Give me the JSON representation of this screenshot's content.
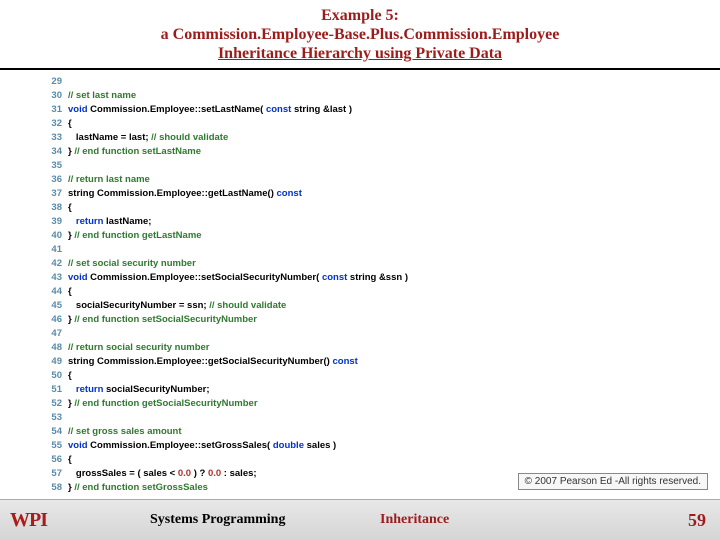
{
  "header": {
    "line1": "Example 5:",
    "line2": "a Commission.Employee-Base.Plus.Commission.Employee",
    "line3": "Inheritance Hierarchy using Private Data"
  },
  "code": {
    "lines": [
      {
        "n": 29,
        "t": []
      },
      {
        "n": 30,
        "t": [
          {
            "c": "cm",
            "s": "// set last name"
          }
        ]
      },
      {
        "n": 31,
        "t": [
          {
            "c": "kw",
            "s": "void"
          },
          {
            "c": "txt",
            "s": " Commission.Employee::setLastName( "
          },
          {
            "c": "kw",
            "s": "const"
          },
          {
            "c": "txt",
            "s": " string &last )"
          }
        ]
      },
      {
        "n": 32,
        "t": [
          {
            "c": "txt",
            "s": "{"
          }
        ]
      },
      {
        "n": 33,
        "t": [
          {
            "c": "txt",
            "s": "   lastName = last; "
          },
          {
            "c": "cm",
            "s": "// should validate"
          }
        ]
      },
      {
        "n": 34,
        "t": [
          {
            "c": "txt",
            "s": "} "
          },
          {
            "c": "cm",
            "s": "// end function setLastName"
          }
        ]
      },
      {
        "n": 35,
        "t": []
      },
      {
        "n": 36,
        "t": [
          {
            "c": "cm",
            "s": "// return last name"
          }
        ]
      },
      {
        "n": 37,
        "t": [
          {
            "c": "txt",
            "s": "string Commission.Employee::getLastName() "
          },
          {
            "c": "kw",
            "s": "const"
          }
        ]
      },
      {
        "n": 38,
        "t": [
          {
            "c": "txt",
            "s": "{"
          }
        ]
      },
      {
        "n": 39,
        "t": [
          {
            "c": "txt",
            "s": "   "
          },
          {
            "c": "kw",
            "s": "return"
          },
          {
            "c": "txt",
            "s": " lastName;"
          }
        ]
      },
      {
        "n": 40,
        "t": [
          {
            "c": "txt",
            "s": "} "
          },
          {
            "c": "cm",
            "s": "// end function getLastName"
          }
        ]
      },
      {
        "n": 41,
        "t": []
      },
      {
        "n": 42,
        "t": [
          {
            "c": "cm",
            "s": "// set social security number"
          }
        ]
      },
      {
        "n": 43,
        "t": [
          {
            "c": "kw",
            "s": "void"
          },
          {
            "c": "txt",
            "s": " Commission.Employee::setSocialSecurityNumber( "
          },
          {
            "c": "kw",
            "s": "const"
          },
          {
            "c": "txt",
            "s": " string &ssn )"
          }
        ]
      },
      {
        "n": 44,
        "t": [
          {
            "c": "txt",
            "s": "{"
          }
        ]
      },
      {
        "n": 45,
        "t": [
          {
            "c": "txt",
            "s": "   socialSecurityNumber = ssn; "
          },
          {
            "c": "cm",
            "s": "// should validate"
          }
        ]
      },
      {
        "n": 46,
        "t": [
          {
            "c": "txt",
            "s": "} "
          },
          {
            "c": "cm",
            "s": "// end function setSocialSecurityNumber"
          }
        ]
      },
      {
        "n": 47,
        "t": []
      },
      {
        "n": 48,
        "t": [
          {
            "c": "cm",
            "s": "// return social security number"
          }
        ]
      },
      {
        "n": 49,
        "t": [
          {
            "c": "txt",
            "s": "string Commission.Employee::getSocialSecurityNumber() "
          },
          {
            "c": "kw",
            "s": "const"
          }
        ]
      },
      {
        "n": 50,
        "t": [
          {
            "c": "txt",
            "s": "{"
          }
        ]
      },
      {
        "n": 51,
        "t": [
          {
            "c": "txt",
            "s": "   "
          },
          {
            "c": "kw",
            "s": "return"
          },
          {
            "c": "txt",
            "s": " socialSecurityNumber;"
          }
        ]
      },
      {
        "n": 52,
        "t": [
          {
            "c": "txt",
            "s": "} "
          },
          {
            "c": "cm",
            "s": "// end function getSocialSecurityNumber"
          }
        ]
      },
      {
        "n": 53,
        "t": []
      },
      {
        "n": 54,
        "t": [
          {
            "c": "cm",
            "s": "// set gross sales amount"
          }
        ]
      },
      {
        "n": 55,
        "t": [
          {
            "c": "kw",
            "s": "void"
          },
          {
            "c": "txt",
            "s": " Commission.Employee::setGrossSales( "
          },
          {
            "c": "kw",
            "s": "double"
          },
          {
            "c": "txt",
            "s": " sales )"
          }
        ]
      },
      {
        "n": 56,
        "t": [
          {
            "c": "txt",
            "s": "{"
          }
        ]
      },
      {
        "n": 57,
        "t": [
          {
            "c": "txt",
            "s": "   grossSales = ( sales < "
          },
          {
            "c": "num",
            "s": "0.0"
          },
          {
            "c": "txt",
            "s": " ) ? "
          },
          {
            "c": "num",
            "s": "0.0"
          },
          {
            "c": "txt",
            "s": " : sales;"
          }
        ]
      },
      {
        "n": 58,
        "t": [
          {
            "c": "txt",
            "s": "} "
          },
          {
            "c": "cm",
            "s": "// end function setGrossSales"
          }
        ]
      }
    ]
  },
  "copyright": "© 2007 Pearson Ed -All rights reserved.",
  "footer": {
    "logo": "WPI",
    "center": "Systems Programming",
    "topic": "Inheritance",
    "page": "59"
  }
}
